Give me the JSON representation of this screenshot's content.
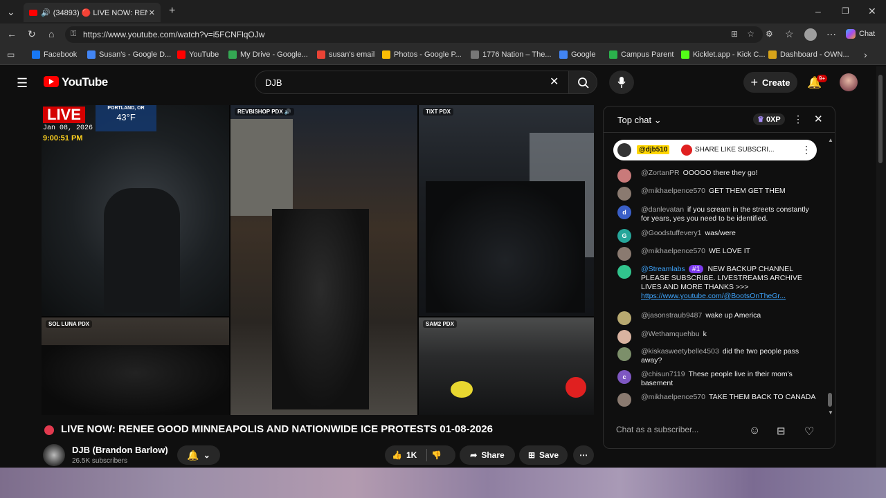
{
  "browser": {
    "tab_title": "(34893) 🔴 LIVE NOW: RENEE",
    "url": "https://www.youtube.com/watch?v=i5FCNFlqOJw",
    "chat_button": "Chat",
    "bookmarks": [
      {
        "label": "Facebook",
        "color": "#1877f2"
      },
      {
        "label": "Susan's - Google D...",
        "color": "#4285f4"
      },
      {
        "label": "YouTube",
        "color": "#ff0000"
      },
      {
        "label": "My Drive - Google...",
        "color": "#34a853"
      },
      {
        "label": "susan's email",
        "color": "#ea4335"
      },
      {
        "label": "Photos - Google P...",
        "color": "#fbbc04"
      },
      {
        "label": "1776 Nation – The...",
        "color": "#777777"
      },
      {
        "label": "Google",
        "color": "#4285f4"
      },
      {
        "label": "Campus Parent",
        "color": "#2bb24c"
      },
      {
        "label": "Kicklet.app - Kick C...",
        "color": "#53fc18"
      },
      {
        "label": "Dashboard - OWN...",
        "color": "#d6a31a"
      }
    ]
  },
  "header": {
    "logo": "YouTube",
    "search_value": "DJB",
    "create_label": "Create",
    "notif_badge": "9+"
  },
  "video": {
    "live_label": "LIVE",
    "weather_city": "PORTLAND, OR",
    "weather_temp": "43°F",
    "date": "Jan 08, 2026",
    "time": "9:00:51 PM",
    "cells": [
      {
        "label": "REVBISHOP PDX 🔊"
      },
      {
        "label": "TIXT PDX"
      },
      {
        "label": "SOL LUNA PDX"
      },
      {
        "label": "SAM2 PDX"
      }
    ]
  },
  "meta": {
    "title": "LIVE NOW: RENEE GOOD MINNEAPOLIS AND NATIONWIDE ICE PROTESTS 01-08-2026",
    "channel": "DJB (Brandon Barlow)",
    "subscribers": "26.5K subscribers",
    "likes": "1K",
    "share": "Share",
    "save": "Save"
  },
  "chat": {
    "header": "Top chat",
    "points": "0XP",
    "pinned_author": "@djb510",
    "pinned_text": "SHARE LIKE SUBSCRI...",
    "input_placeholder": "Chat as a subscriber...",
    "messages": [
      {
        "author": "@ZortanPR",
        "text": "OOOOO there they go!",
        "avatar": "",
        "color": "#c97a7a"
      },
      {
        "author": "@mikhaelpence570",
        "text": "GET THEM GET THEM",
        "avatar": "",
        "color": "#8a7a70"
      },
      {
        "author": "@danlevatan",
        "text": "if you scream in the streets constantly for years, yes you need to be identified.",
        "avatar": "d",
        "color": "#3a5fc8"
      },
      {
        "author": "@Goodstuffevery1",
        "text": "was/were",
        "avatar": "G",
        "color": "#26a69a"
      },
      {
        "author": "@mikhaelpence570",
        "text": "WE LOVE IT",
        "avatar": "",
        "color": "#8a7a70"
      },
      {
        "author": "@Streamlabs",
        "badge": "#1",
        "text": "NEW BACKUP CHANNEL PLEASE SUBSCRIBE. LIVESTREAMS ARCHIVE LIVES AND MORE THANKS >>> ",
        "link": "https://www.youtube.com/@BootsOnTheGr...",
        "avatar": "",
        "color": "#31c48d"
      },
      {
        "author": "@jasonstraub9487",
        "text": "wake up America",
        "avatar": "",
        "color": "#b8a970"
      },
      {
        "author": "@Wethamquehbu",
        "text": "k",
        "avatar": "",
        "color": "#d9b3a0"
      },
      {
        "author": "@kiskasweetybelle4503",
        "text": "did the two people pass away?",
        "avatar": "",
        "color": "#7c8f6a"
      },
      {
        "author": "@chisun7119",
        "text": "These people live in their mom's basement",
        "avatar": "c",
        "color": "#7e57c2"
      },
      {
        "author": "@mikhaelpence570",
        "text": "TAKE THEM BACK TO CANADA",
        "avatar": "",
        "color": "#8a7a70"
      }
    ]
  }
}
